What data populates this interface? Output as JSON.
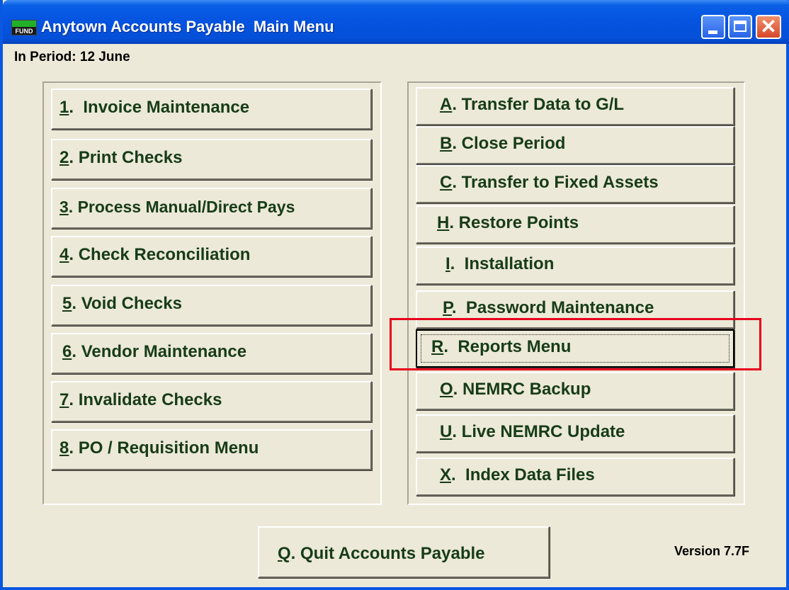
{
  "window": {
    "title": "Anytown Accounts Payable  Main Menu",
    "icon_text": "FUND",
    "minimize_icon": "minimize-icon",
    "maximize_icon": "maximize-icon",
    "close_icon": "close-icon",
    "close_glyph": "✕"
  },
  "period_label": "In Period: 12 June",
  "left_menu": [
    {
      "key": "1",
      "label": ".  Invoice Maintenance"
    },
    {
      "key": "2",
      "label": ". Print Checks"
    },
    {
      "key": "3",
      "label": ". Process Manual/Direct Pays"
    },
    {
      "key": "4",
      "label": ". Check Reconciliation"
    },
    {
      "key": "5",
      "label": ". Void Checks"
    },
    {
      "key": "6",
      "label": ". Vendor Maintenance"
    },
    {
      "key": "7",
      "label": ". Invalidate Checks"
    },
    {
      "key": "8",
      "label": ". PO / Requisition Menu"
    }
  ],
  "right_menu": [
    {
      "key": "A",
      "label": ". Transfer Data to G/L"
    },
    {
      "key": "B",
      "label": ". Close Period"
    },
    {
      "key": "C",
      "label": ". Transfer to Fixed Assets"
    },
    {
      "key": "H",
      "label": ". Restore Points"
    },
    {
      "key": "I",
      "label": ".  Installation"
    },
    {
      "key": "P",
      "label": ".  Password Maintenance"
    },
    {
      "key": "R",
      "label": ".  Reports Menu"
    },
    {
      "key": "O",
      "label": ". NEMRC Backup"
    },
    {
      "key": "U",
      "label": ". Live NEMRC Update"
    },
    {
      "key": "X",
      "label": ".  Index Data Files"
    }
  ],
  "quit": {
    "key": "Q",
    "label": ". Quit Accounts Payable"
  },
  "version": "Version 7.7F",
  "colors": {
    "highlight": "#e8001c",
    "button_text": "#173c17",
    "titlebar": "#0553e0"
  }
}
